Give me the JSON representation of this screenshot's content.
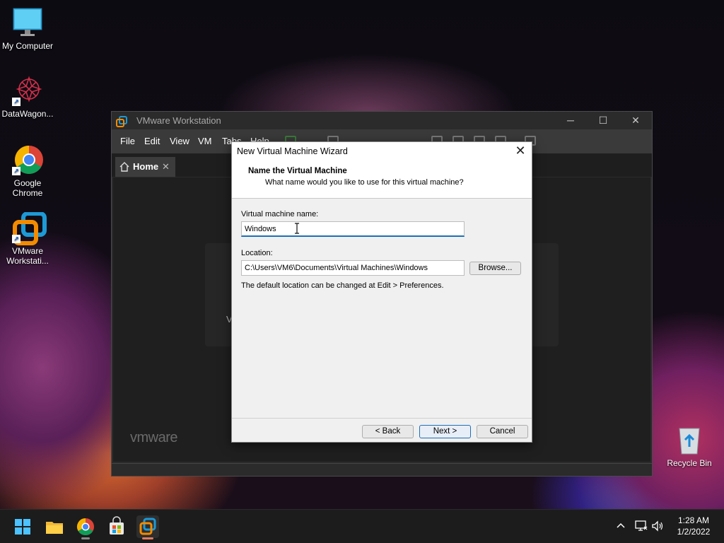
{
  "desktop": {
    "icons": [
      {
        "label": "My Computer",
        "icon": "monitor-icon"
      },
      {
        "label": "DataWagon...",
        "icon": "datawagon-icon"
      },
      {
        "label": "Google Chrome",
        "icon": "chrome-icon"
      },
      {
        "label": "VMware Workstati...",
        "icon": "vmware-icon"
      },
      {
        "label": "Recycle Bin",
        "icon": "recycle-bin-icon"
      }
    ]
  },
  "vmware": {
    "title": "VMware Workstation",
    "menus": [
      "File",
      "Edit",
      "View",
      "VM",
      "Tabs",
      "Help"
    ],
    "tab_label": "Home",
    "logo_text": "vmware",
    "content_fragment": "V"
  },
  "wizard": {
    "title": "New Virtual Machine Wizard",
    "header_title": "Name the Virtual Machine",
    "header_subtitle": "What name would you like to use for this virtual machine?",
    "name_label": "Virtual machine name:",
    "name_value": "Windows",
    "location_label": "Location:",
    "location_value": "C:\\Users\\VM6\\Documents\\Virtual Machines\\Windows",
    "browse_label": "Browse...",
    "hint": "The default location can be changed at Edit > Preferences.",
    "back_label": "< Back",
    "next_label": "Next >",
    "cancel_label": "Cancel"
  },
  "taskbar": {
    "apps": [
      "start-icon",
      "file-explorer-icon",
      "chrome-icon",
      "store-icon",
      "vmware-icon"
    ],
    "time": "1:28 AM",
    "date": "1/2/2022"
  },
  "colors": {
    "accent": "#1c6fb8",
    "vmware_orange": "#f38b00",
    "vmware_blue": "#1d9ad6"
  }
}
